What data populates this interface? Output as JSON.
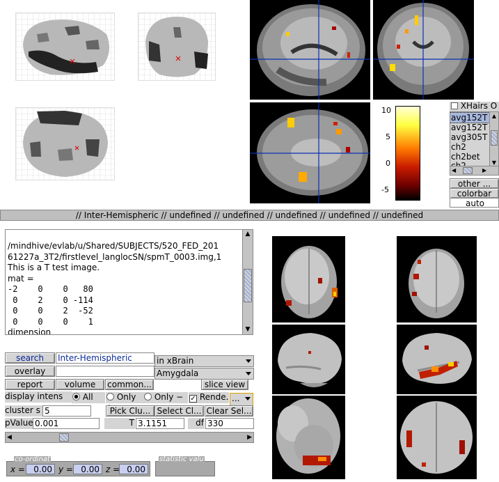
{
  "title_bar": "// Inter-Hemispheric // undefined // undefined // undefined // undefined // undefined",
  "colorbar": {
    "ticks": [
      "10",
      "5",
      "0",
      "-5"
    ]
  },
  "image_list": {
    "xhairs_label": "XHairs O",
    "items": [
      "avg152T",
      "avg152T",
      "avg305T",
      "ch2",
      "ch2bet",
      "ch2..."
    ],
    "selected_index": 0
  },
  "right_buttons": {
    "other": "other ...",
    "colorbar": "colorbar",
    "auto": "auto"
  },
  "info": {
    "lines": [
      "/mindhive/evlab/u/Shared/SUBJECTS/520_FED_201",
      "61227a_3T2/firstlevel_langlocSN/spmT_0003.img,1",
      "This is a T test image.",
      "mat =",
      "-2    0    0   80",
      " 0    2    0 -114",
      " 0    0    2  -52",
      " 0    0    0    1",
      "dimension"
    ]
  },
  "controls": {
    "search_label": "search",
    "search_value": "Inter-Hemispheric",
    "atlas_select": "in xBrain",
    "overlay_label": "overlay",
    "overlay_select": "Amygdala",
    "report_label": "report",
    "volume_label": "volume",
    "common_label": "common...",
    "slice_view_label": "slice view",
    "display_intens_label": "display intens",
    "radio_all": "All",
    "radio_only_pos": "Only +",
    "radio_only_neg": "Only −",
    "render_label": "Rende...",
    "render_checked": true,
    "more_label": "...",
    "cluster_size_label": "cluster s",
    "cluster_size_value": "5",
    "pick_cluster_label": "Pick Clu...",
    "select_cluster_label": "Select Cl...",
    "clear_selection_label": "Clear Sel...",
    "pvalue_label": "pValue",
    "pvalue_value": "0.001",
    "t_label": "T",
    "t_value": "3.1151",
    "df_label": "df",
    "df_value": "330",
    "scroll_position": 0.2
  },
  "coords": {
    "panel_label": "co-ordinat",
    "x_label": "x =",
    "x_value": "0.00",
    "y_label": "y =",
    "y_value": "0.00",
    "z_label": "z =",
    "z_value": "0.00",
    "stat_label": "statistic valu"
  },
  "colors": {
    "panel": "#d4d4d4",
    "selection": "#a7b7dd",
    "crosshair": "#0b2fb5",
    "coord_field": "#c8cff0"
  }
}
